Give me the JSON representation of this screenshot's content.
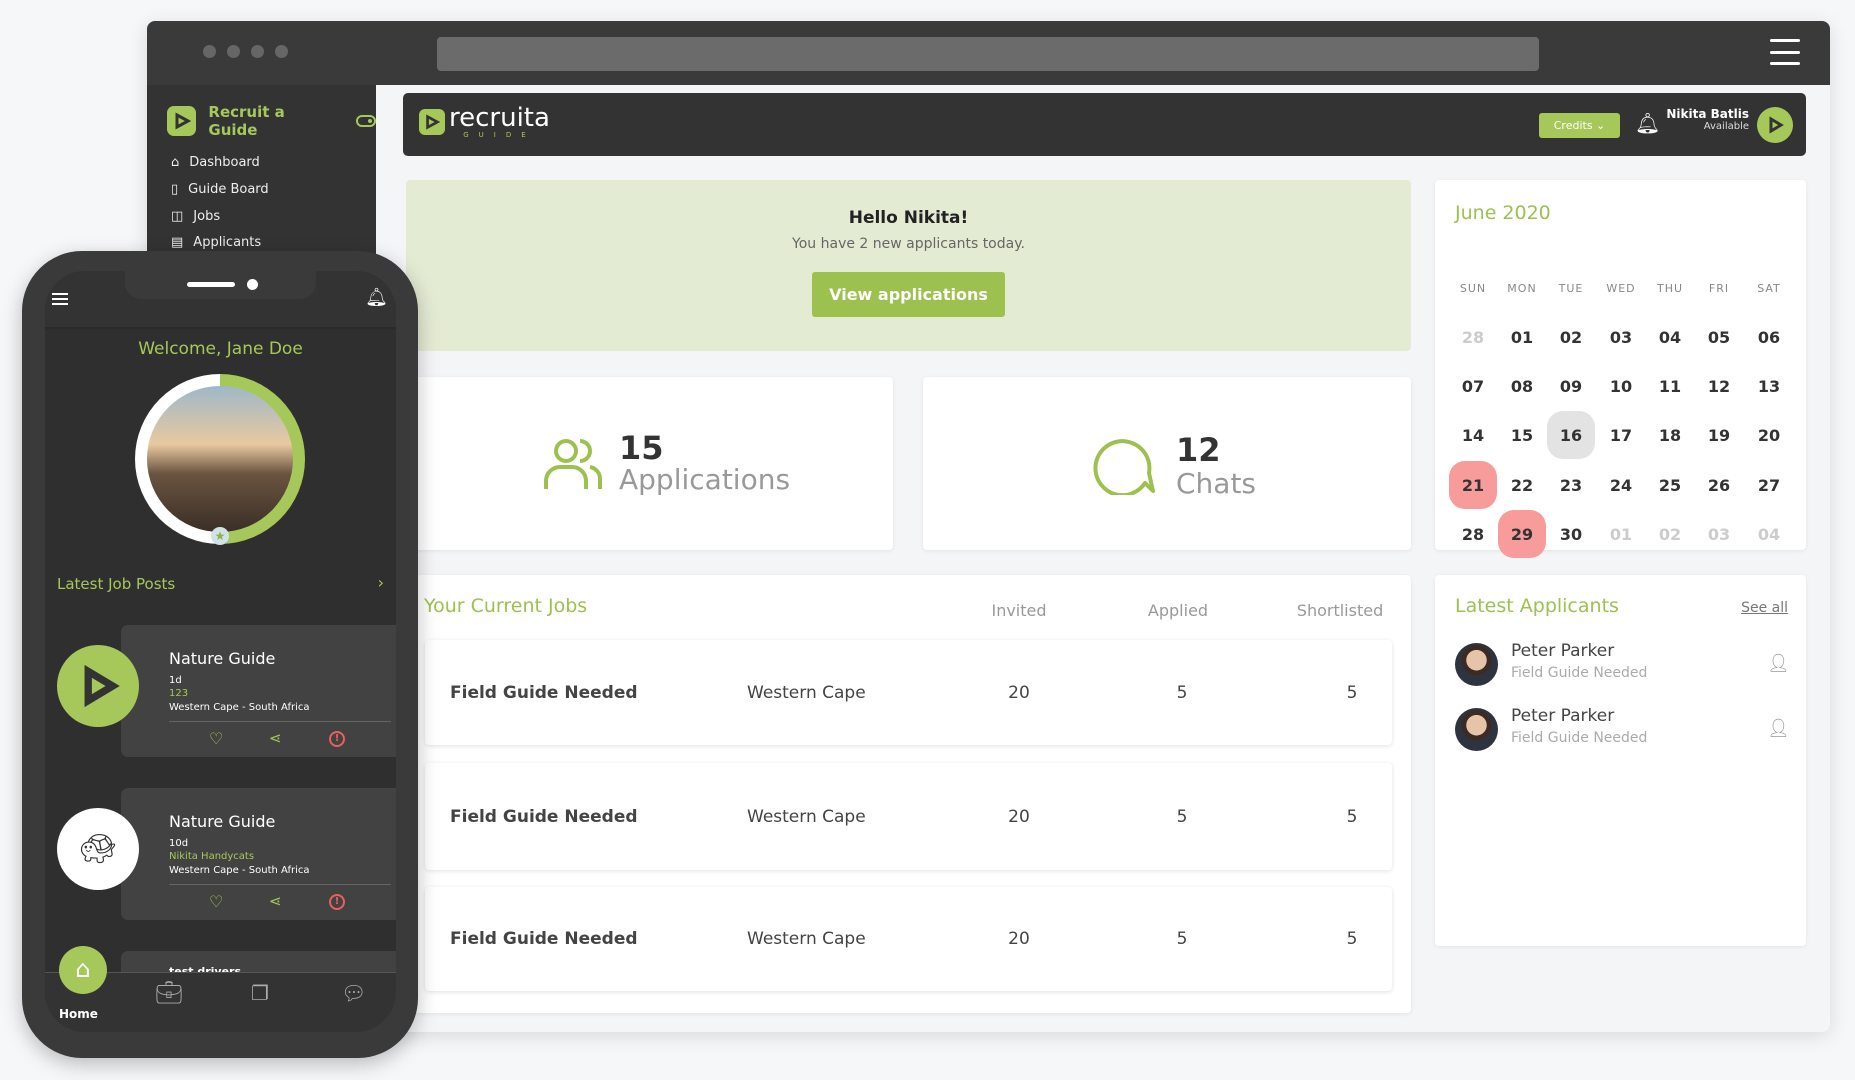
{
  "browser": {
    "menu_icon": "hamburger-icon"
  },
  "sidebar": {
    "brand": "Recruit a Guide",
    "items": [
      {
        "label": "Dashboard",
        "icon": "home-icon"
      },
      {
        "label": "Guide Board",
        "icon": "clipboard-icon"
      },
      {
        "label": "Jobs",
        "icon": "briefcase-icon"
      },
      {
        "label": "Applicants",
        "icon": "list-icon"
      }
    ]
  },
  "header": {
    "logo": "recruita",
    "logo_sub": "GUIDE",
    "credits_label": "Credits",
    "user_name": "Nikita Batlis",
    "user_status": "Available"
  },
  "banner": {
    "title": "Hello Nikita!",
    "subtitle": "You have 2 new applicants today.",
    "button": "View applications"
  },
  "stats": [
    {
      "value": "15",
      "label": "Applications",
      "icon": "users-icon"
    },
    {
      "value": "12",
      "label": "Chats",
      "icon": "chat-icon"
    }
  ],
  "jobs": {
    "title": "Your Current Jobs",
    "columns": [
      "Invited",
      "Applied",
      "Shortlisted"
    ],
    "rows": [
      {
        "title": "Field Guide Needed",
        "location": "Western Cape",
        "invited": "20",
        "applied": "5",
        "shortlisted": "5"
      },
      {
        "title": "Field Guide Needed",
        "location": "Western Cape",
        "invited": "20",
        "applied": "5",
        "shortlisted": "5"
      },
      {
        "title": "Field Guide Needed",
        "location": "Western Cape",
        "invited": "20",
        "applied": "5",
        "shortlisted": "5"
      }
    ]
  },
  "calendar": {
    "title": "June 2020",
    "days": [
      "SUN",
      "MON",
      "TUE",
      "WED",
      "THU",
      "FRI",
      "SAT"
    ],
    "weeks": [
      [
        "28",
        "01",
        "02",
        "03",
        "04",
        "05",
        "06"
      ],
      [
        "07",
        "08",
        "09",
        "10",
        "11",
        "12",
        "13"
      ],
      [
        "14",
        "15",
        "16",
        "17",
        "18",
        "19",
        "20"
      ],
      [
        "21",
        "22",
        "23",
        "24",
        "25",
        "26",
        "27"
      ],
      [
        "28",
        "29",
        "30",
        "01",
        "02",
        "03",
        "04"
      ]
    ],
    "today": "16",
    "highlighted": [
      "21",
      "29"
    ],
    "colors": {
      "highlight": "#f79b9b",
      "today": "#e3e3e3",
      "accent": "#9dc14f"
    }
  },
  "applicants": {
    "title": "Latest Applicants",
    "see_all": "See all",
    "items": [
      {
        "name": "Peter Parker",
        "job": "Field Guide Needed"
      },
      {
        "name": "Peter Parker",
        "job": "Field Guide Needed"
      }
    ]
  },
  "phone": {
    "welcome": "Welcome, Jane Doe",
    "latest": "Latest Job Posts",
    "posts": [
      {
        "title": "Nature Guide",
        "age": "1d",
        "company": "123",
        "location": "Western Cape - South Africa"
      },
      {
        "title": "Nature Guide",
        "age": "10d",
        "company": "Nikita Handycats",
        "location": "Western Cape - South Africa"
      },
      {
        "title": "test drivers"
      }
    ],
    "nav": {
      "home": "Home"
    }
  }
}
